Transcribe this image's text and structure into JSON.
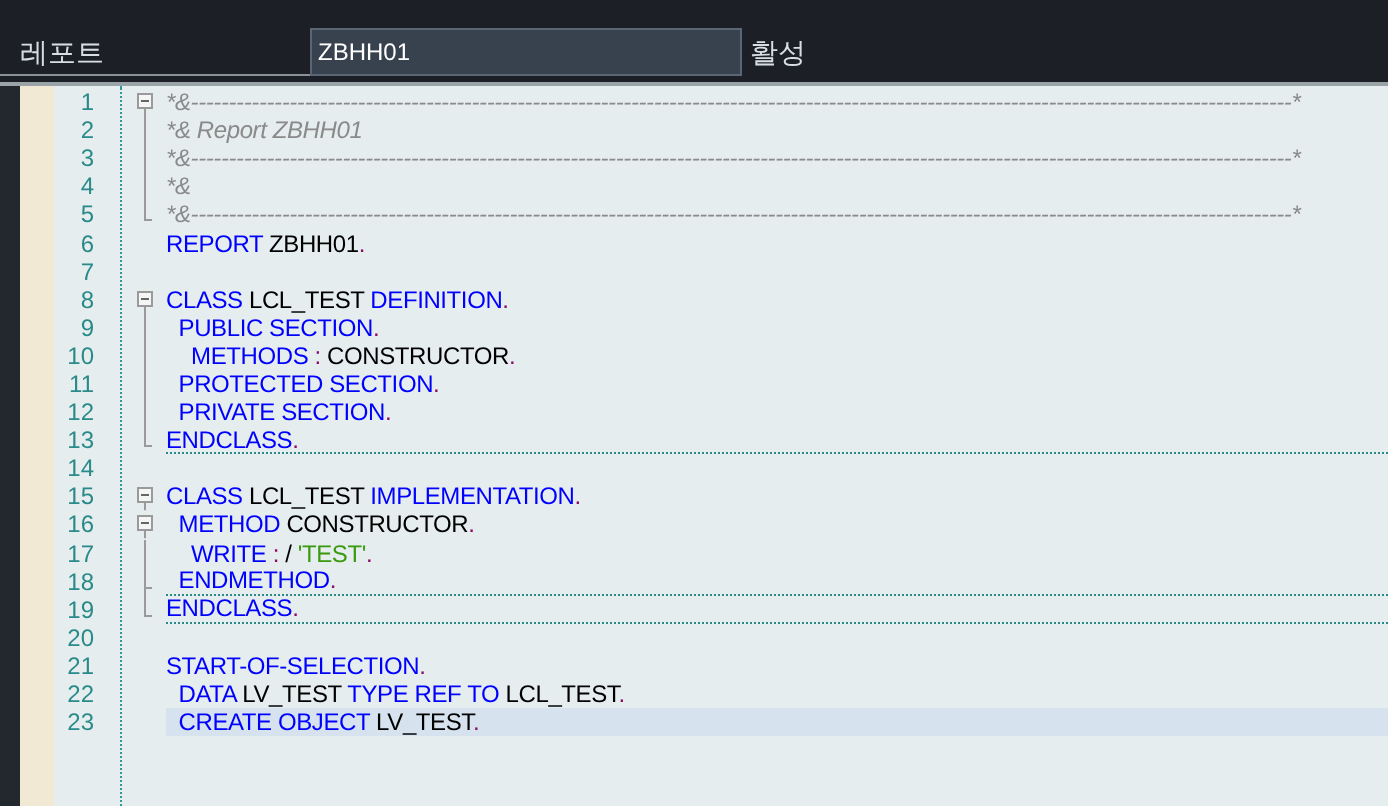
{
  "header": {
    "label": "레포트",
    "program_name": "ZBHH01",
    "status": "활성"
  },
  "lines": [
    {
      "number": "1",
      "kind": "fold-start",
      "tokens": [
        {
          "kind": "comment",
          "text": "*&-------------------------------------------------------------------------------------------------------------------------------------------------*"
        }
      ]
    },
    {
      "number": "2",
      "kind": "fold-line",
      "tokens": [
        {
          "kind": "comment",
          "text": "*& Report ZBHH01"
        }
      ]
    },
    {
      "number": "3",
      "kind": "fold-line",
      "tokens": [
        {
          "kind": "comment",
          "text": "*&-------------------------------------------------------------------------------------------------------------------------------------------------*"
        }
      ]
    },
    {
      "number": "4",
      "kind": "fold-line",
      "tokens": [
        {
          "kind": "comment",
          "text": "*&"
        }
      ]
    },
    {
      "number": "5",
      "kind": "fold-end",
      "tokens": [
        {
          "kind": "comment",
          "text": "*&-------------------------------------------------------------------------------------------------------------------------------------------------*"
        }
      ]
    },
    {
      "number": "6",
      "kind": "plain",
      "tokens": [
        {
          "kind": "keyword",
          "text": "REPORT"
        },
        {
          "kind": "ident",
          "text": " ZBHH01"
        },
        {
          "kind": "punct",
          "text": "."
        }
      ]
    },
    {
      "number": "7",
      "kind": "plain"
    },
    {
      "number": "8",
      "kind": "fold-start",
      "tokens": [
        {
          "kind": "keyword",
          "text": "CLASS"
        },
        {
          "kind": "ident",
          "text": " LCL_TEST "
        },
        {
          "kind": "keyword",
          "text": "DEFINITION"
        },
        {
          "kind": "punct",
          "text": "."
        }
      ]
    },
    {
      "number": "9",
      "kind": "fold-line",
      "tokens": [
        {
          "kind": "keyword",
          "text": "  PUBLIC SECTION"
        },
        {
          "kind": "punct",
          "text": "."
        }
      ]
    },
    {
      "number": "10",
      "kind": "fold-line",
      "tokens": [
        {
          "kind": "keyword",
          "text": "    METHODS "
        },
        {
          "kind": "punct",
          "text": ":"
        },
        {
          "kind": "ident",
          "text": " CONSTRUCTOR"
        },
        {
          "kind": "punct",
          "text": "."
        }
      ]
    },
    {
      "number": "11",
      "kind": "fold-line",
      "tokens": [
        {
          "kind": "keyword",
          "text": "  PROTECTED SECTION"
        },
        {
          "kind": "punct",
          "text": "."
        }
      ]
    },
    {
      "number": "12",
      "kind": "fold-line",
      "tokens": [
        {
          "kind": "keyword",
          "text": "  PRIVATE SECTION"
        },
        {
          "kind": "punct",
          "text": "."
        }
      ]
    },
    {
      "number": "13",
      "kind": "fold-end",
      "divider_below": true,
      "tokens": [
        {
          "kind": "keyword",
          "text": "ENDCLASS"
        },
        {
          "kind": "punct",
          "text": "."
        }
      ]
    },
    {
      "number": "14",
      "kind": "plain"
    },
    {
      "number": "15",
      "kind": "fold-start",
      "tokens": [
        {
          "kind": "keyword",
          "text": "CLASS"
        },
        {
          "kind": "ident",
          "text": " LCL_TEST "
        },
        {
          "kind": "keyword",
          "text": "IMPLEMENTATION"
        },
        {
          "kind": "punct",
          "text": "."
        }
      ]
    },
    {
      "number": "16",
      "kind": "fold-start",
      "tokens": [
        {
          "kind": "keyword",
          "text": "  METHOD"
        },
        {
          "kind": "ident",
          "text": " CONSTRUCTOR"
        },
        {
          "kind": "punct",
          "text": "."
        }
      ]
    },
    {
      "number": "17",
      "kind": "fold-line",
      "tokens": [
        {
          "kind": "keyword",
          "text": "    WRITE "
        },
        {
          "kind": "punct",
          "text": ":"
        },
        {
          "kind": "ident",
          "text": " / "
        },
        {
          "kind": "string",
          "text": "'TEST'"
        },
        {
          "kind": "punct",
          "text": "."
        }
      ]
    },
    {
      "number": "18",
      "kind": "fold-tee",
      "divider_below": true,
      "tokens": [
        {
          "kind": "keyword",
          "text": "  ENDMETHOD"
        },
        {
          "kind": "punct",
          "text": "."
        }
      ]
    },
    {
      "number": "19",
      "kind": "fold-end",
      "divider_below": true,
      "tokens": [
        {
          "kind": "keyword",
          "text": "ENDCLASS"
        },
        {
          "kind": "punct",
          "text": "."
        }
      ]
    },
    {
      "number": "20",
      "kind": "plain"
    },
    {
      "number": "21",
      "kind": "plain",
      "tokens": [
        {
          "kind": "keyword",
          "text": "START-OF-SELECTION"
        },
        {
          "kind": "punct",
          "text": "."
        }
      ]
    },
    {
      "number": "22",
      "kind": "plain",
      "tokens": [
        {
          "kind": "keyword",
          "text": "  DATA"
        },
        {
          "kind": "ident",
          "text": " LV_TEST "
        },
        {
          "kind": "keyword",
          "text": "TYPE REF TO"
        },
        {
          "kind": "ident",
          "text": " LCL_TEST"
        },
        {
          "kind": "punct",
          "text": "."
        }
      ]
    },
    {
      "number": "23",
      "kind": "plain",
      "current": true,
      "tokens": [
        {
          "kind": "keyword",
          "text": "  CREATE OBJECT"
        },
        {
          "kind": "ident",
          "text": " LV_TEST"
        },
        {
          "kind": "punct",
          "text": "."
        }
      ]
    }
  ]
}
